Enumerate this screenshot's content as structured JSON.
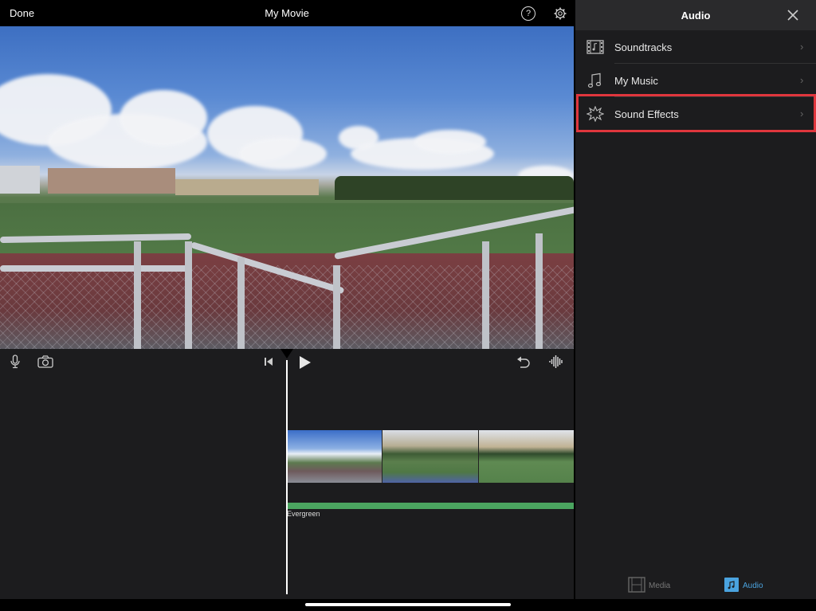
{
  "topbar": {
    "done_label": "Done",
    "title": "My Movie",
    "help_glyph": "?"
  },
  "preview": {
    "description": "Video frame of a soccer field behind chain-link fence"
  },
  "timeline": {
    "tools": [
      "microphone-icon",
      "camera-icon",
      "skip-to-start-icon",
      "play-icon",
      "undo-icon",
      "waveform-icon"
    ],
    "clips_count": 3,
    "audio_track": {
      "label": "Evergreen",
      "color": "#4ba560"
    }
  },
  "audio_panel": {
    "title": "Audio",
    "items": [
      {
        "label": "Soundtracks",
        "icon": "soundtracks-film-icon"
      },
      {
        "label": "My Music",
        "icon": "music-note-icon"
      },
      {
        "label": "Sound Effects",
        "icon": "sound-effects-burst-icon",
        "highlighted": true
      }
    ],
    "chevron": "›",
    "highlight_color": "#e0363d"
  },
  "bottom_tabs": {
    "items": [
      {
        "label": "Media",
        "active": false
      },
      {
        "label": "Audio",
        "active": true
      }
    ],
    "active_color": "#4aa3df"
  }
}
